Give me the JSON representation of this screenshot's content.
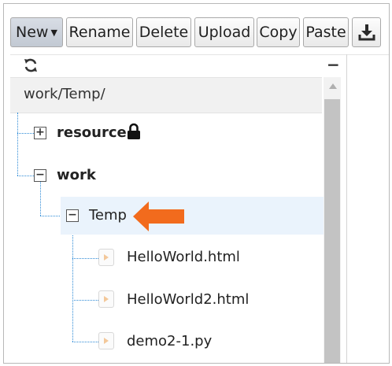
{
  "toolbar": {
    "new_label": "New",
    "rename_label": "Rename",
    "delete_label": "Delete",
    "upload_label": "Upload",
    "copy_label": "Copy",
    "paste_label": "Paste",
    "download_icon": "download-icon"
  },
  "panel": {
    "refresh_icon": "refresh-icon",
    "collapse_symbol": "−",
    "current_path": "work/Temp/"
  },
  "tree": {
    "resource": {
      "label": "resource",
      "toggle": "+",
      "locked": true
    },
    "work": {
      "label": "work",
      "toggle": "−"
    },
    "temp": {
      "label": "Temp",
      "toggle": "−",
      "selected": true
    },
    "files": [
      {
        "label": "HelloWorld.html"
      },
      {
        "label": "HelloWorld2.html"
      },
      {
        "label": "demo2-1.py"
      }
    ]
  },
  "annotation": {
    "arrow_color": "#f26b1d"
  }
}
